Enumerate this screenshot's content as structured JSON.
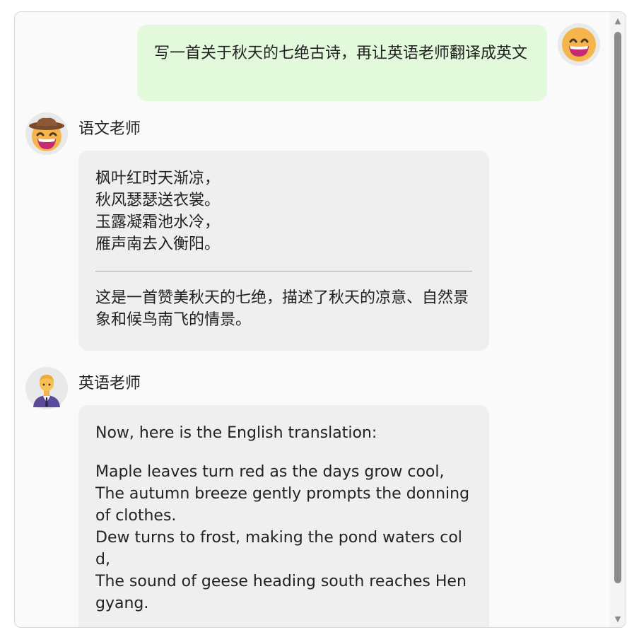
{
  "chat": {
    "user_message": "写一首关于秋天的七绝古诗，再让英语老师翻译成英文",
    "chinese_teacher": {
      "name": "语文老师",
      "poem_lines": [
        "枫叶红时天渐凉，",
        "秋风瑟瑟送衣裳。",
        "玉露凝霜池水冷，",
        "雁声南去入衡阳。"
      ],
      "explanation": "这是一首赞美秋天的七绝，描述了秋天的凉意、自然景象和候鸟南飞的情景。"
    },
    "english_teacher": {
      "name": "英语老师",
      "intro": "Now, here is the English translation:",
      "lines": [
        "Maple leaves turn red as the days grow cool,",
        "The autumn breeze gently prompts the donning of clothes.",
        "Dew turns to frost, making the pond waters cold,",
        "The sound of geese heading south reaches Hengyang."
      ]
    }
  },
  "colors": {
    "user_bubble": "#e2f9dc",
    "bot_bubble": "#efefef",
    "scroll_thumb": "#8b8b8b"
  },
  "icons": {
    "user_avatar": "grinning-face-icon",
    "chinese_teacher_avatar": "cowboy-face-icon",
    "english_teacher_avatar": "teacher-person-icon"
  }
}
